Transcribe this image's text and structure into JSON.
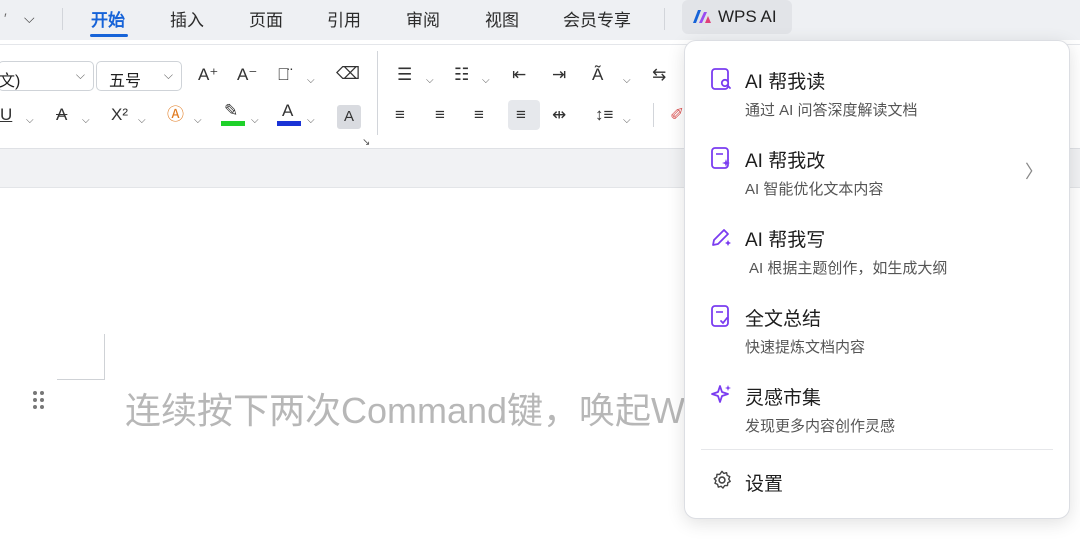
{
  "tabs": [
    "开始",
    "插入",
    "页面",
    "引用",
    "审阅",
    "视图",
    "会员专享"
  ],
  "wps_ai": {
    "label": "WPS AI"
  },
  "ribbon": {
    "font_value": "文)",
    "size_value": "五号",
    "highlight_color": "#1fd12a",
    "font_color": "#1a33d6"
  },
  "document": {
    "placeholder": "连续按下两次Command键，唤起WPS AI"
  },
  "menu": {
    "items": [
      {
        "title": "AI 帮我读",
        "desc": "通过 AI 问答深度解读文档",
        "icon": "document-search-icon"
      },
      {
        "title": "AI 帮我改",
        "desc": "AI 智能优化文本内容",
        "icon": "document-sparkle-icon",
        "has_submenu": true
      },
      {
        "title": "AI 帮我写",
        "desc": "AI 根据主题创作，如生成大纲",
        "icon": "pen-sparkle-icon"
      },
      {
        "title": "全文总结",
        "desc": "快速提炼文档内容",
        "icon": "document-check-icon"
      },
      {
        "title": "灵感市集",
        "desc": "发现更多内容创作灵感",
        "icon": "sparkle-icon"
      }
    ],
    "settings": "设置",
    "accent": "#7a3cf0"
  }
}
